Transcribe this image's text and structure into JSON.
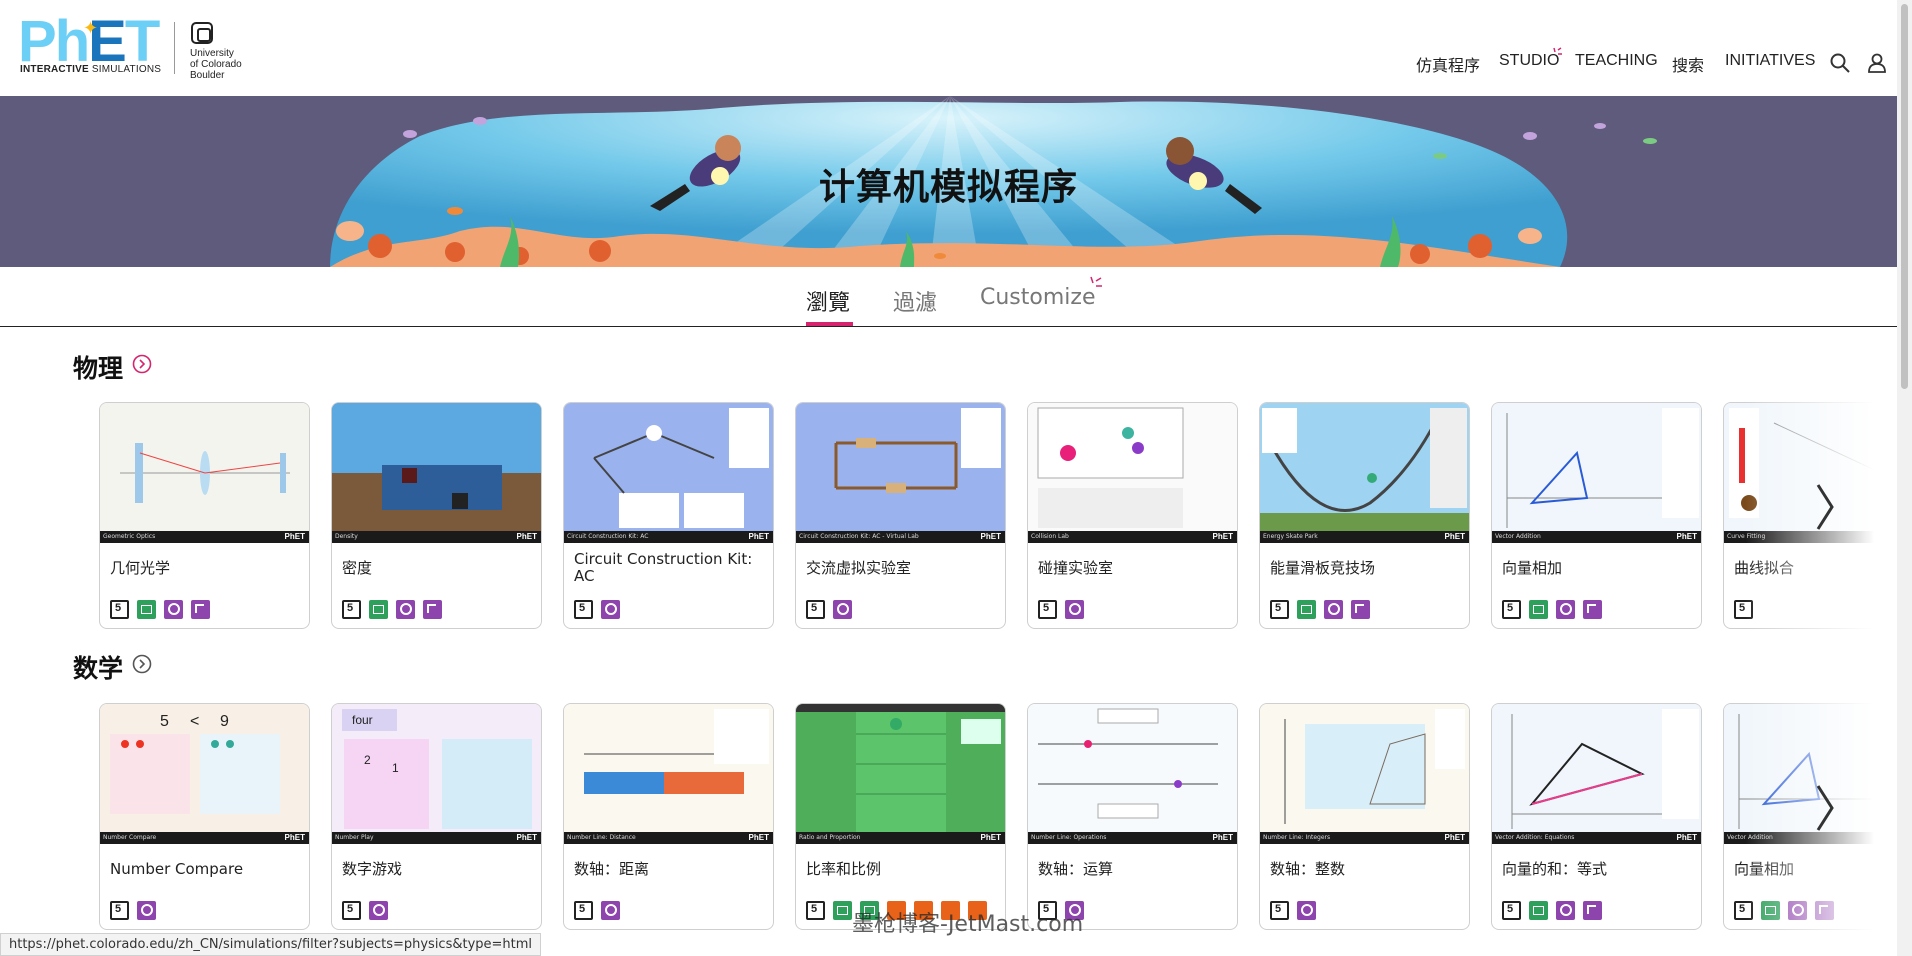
{
  "header": {
    "logo_text": "PhET",
    "logo_subtitle_bold": "INTERACTIVE",
    "logo_subtitle": "SIMULATIONS",
    "partner": "University\nof Colorado\nBoulder",
    "nav": [
      "仿真程序",
      "STUDIO",
      "TEACHING",
      "搜索",
      "INITIATIVES"
    ]
  },
  "hero": {
    "title": "计算机模拟程序"
  },
  "tabs": [
    {
      "label": "瀏覽",
      "active": true
    },
    {
      "label": "過濾",
      "active": false
    },
    {
      "label": "Customize",
      "active": false
    }
  ],
  "sections": [
    {
      "title": "物理",
      "cards": [
        {
          "title": "几何光学",
          "thumb_label": "Geometric Optics",
          "thumb_theme": "optics",
          "badges": [
            "html5",
            "keyboard",
            "zoom",
            "touch"
          ]
        },
        {
          "title": "密度",
          "thumb_label": "Density",
          "thumb_theme": "density",
          "badges": [
            "html5",
            "keyboard",
            "zoom",
            "touch"
          ]
        },
        {
          "title": "Circuit Construction Kit: AC",
          "thumb_label": "Circuit Construction Kit: AC",
          "thumb_theme": "circuit",
          "badges": [
            "html5",
            "zoom"
          ]
        },
        {
          "title": "交流虚拟实验室",
          "thumb_label": "Circuit Construction Kit: AC - Virtual Lab",
          "thumb_theme": "circuit2",
          "badges": [
            "html5",
            "zoom"
          ]
        },
        {
          "title": "碰撞实验室",
          "thumb_label": "Collision Lab",
          "thumb_theme": "collision",
          "badges": [
            "html5",
            "zoom"
          ]
        },
        {
          "title": "能量滑板竞技场",
          "thumb_label": "Energy Skate Park",
          "thumb_theme": "skate",
          "badges": [
            "html5",
            "keyboard",
            "zoom",
            "touch"
          ]
        },
        {
          "title": "向量相加",
          "thumb_label": "Vector Addition",
          "thumb_theme": "vector",
          "badges": [
            "html5",
            "keyboard",
            "zoom",
            "touch"
          ]
        },
        {
          "title": "曲线拟合",
          "thumb_label": "Curve Fitting",
          "thumb_theme": "curve",
          "badges": [
            "html5"
          ]
        }
      ]
    },
    {
      "title": "数学",
      "cards": [
        {
          "title": "Number Compare",
          "thumb_label": "Number Compare",
          "thumb_theme": "numcompare",
          "badges": [
            "html5",
            "zoom"
          ]
        },
        {
          "title": "数字游戏",
          "thumb_label": "Number Play",
          "thumb_theme": "numplay",
          "badges": [
            "html5",
            "zoom"
          ]
        },
        {
          "title": "数轴：距离",
          "thumb_label": "Number Line: Distance",
          "thumb_theme": "nldistance",
          "badges": [
            "html5",
            "zoom"
          ]
        },
        {
          "title": "比率和比例",
          "thumb_label": "Ratio and Proportion",
          "thumb_theme": "ratio",
          "badges": [
            "html5",
            "keyboard",
            "keyboard",
            "orange",
            "orange",
            "orange",
            "orange"
          ]
        },
        {
          "title": "数轴：运算",
          "thumb_label": "Number Line: Operations",
          "thumb_theme": "nlops",
          "badges": [
            "html5",
            "zoom"
          ]
        },
        {
          "title": "数轴：整数",
          "thumb_label": "Number Line: Integers",
          "thumb_theme": "nlint",
          "badges": [
            "html5",
            "zoom"
          ]
        },
        {
          "title": "向量的和：等式",
          "thumb_label": "Vector Addition: Equations",
          "thumb_theme": "vecsum",
          "badges": [
            "html5",
            "keyboard",
            "zoom",
            "touch"
          ]
        },
        {
          "title": "向量相加",
          "thumb_label": "Vector Addition",
          "thumb_theme": "vector",
          "badges": [
            "html5",
            "keyboard",
            "zoom",
            "touch"
          ]
        }
      ]
    }
  ],
  "thumb_footer_brand": "PhET",
  "status_url": "https://phet.colorado.edu/zh_CN/simulations/filter?subjects=physics&type=html",
  "watermark": "墨枪博客-JetMast.com",
  "colors": {
    "accent": "#D6246E",
    "hero_bg": "#5E5B7C",
    "water": "#6EC6E8",
    "phet_light_blue": "#6CCFF6",
    "phet_dark_blue": "#1B75BC"
  }
}
